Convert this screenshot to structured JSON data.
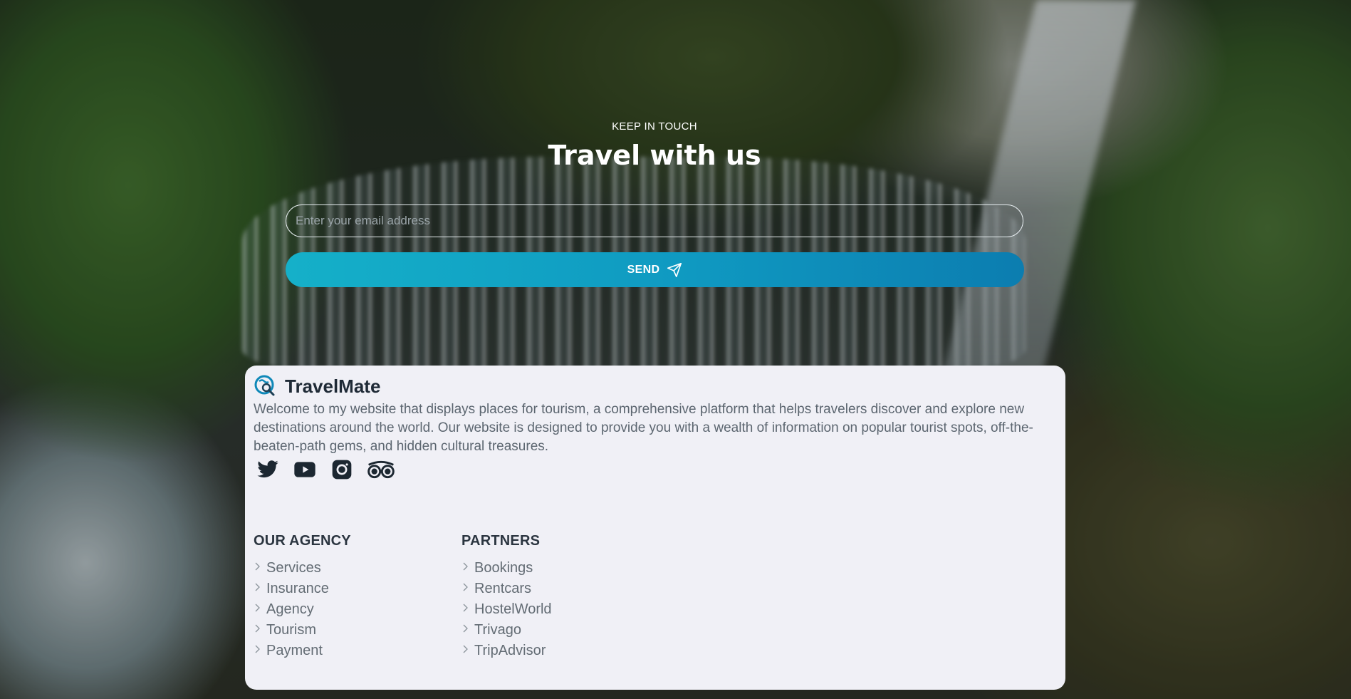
{
  "hero": {
    "eyebrow": "KEEP IN TOUCH",
    "title": "Travel with us",
    "email_placeholder": "Enter your email address",
    "send_label": "SEND"
  },
  "footer": {
    "brand_name": "TravelMate",
    "about": "Welcome to my website that displays places for tourism, a comprehensive platform that helps travelers discover and explore new destinations around the world. Our website is designed to provide you with a wealth of information on popular tourist spots, off-the-beaten-path gems, and hidden cultural treasures.",
    "socials": [
      {
        "icon": "twitter-icon"
      },
      {
        "icon": "youtube-icon"
      },
      {
        "icon": "instagram-icon"
      },
      {
        "icon": "tripadvisor-icon"
      }
    ],
    "columns": [
      {
        "title": "OUR AGENCY",
        "links": [
          "Services",
          "Insurance",
          "Agency",
          "Tourism",
          "Payment"
        ]
      },
      {
        "title": "PARTNERS",
        "links": [
          "Bookings",
          "Rentcars",
          "HostelWorld",
          "Trivago",
          "TripAdvisor"
        ]
      }
    ]
  },
  "colors": {
    "accent_start": "#15b0c9",
    "accent_end": "#0c7db0",
    "card_bg": "#f0f0f6",
    "heading_text": "#1f2a36",
    "body_text": "#5c6670"
  }
}
